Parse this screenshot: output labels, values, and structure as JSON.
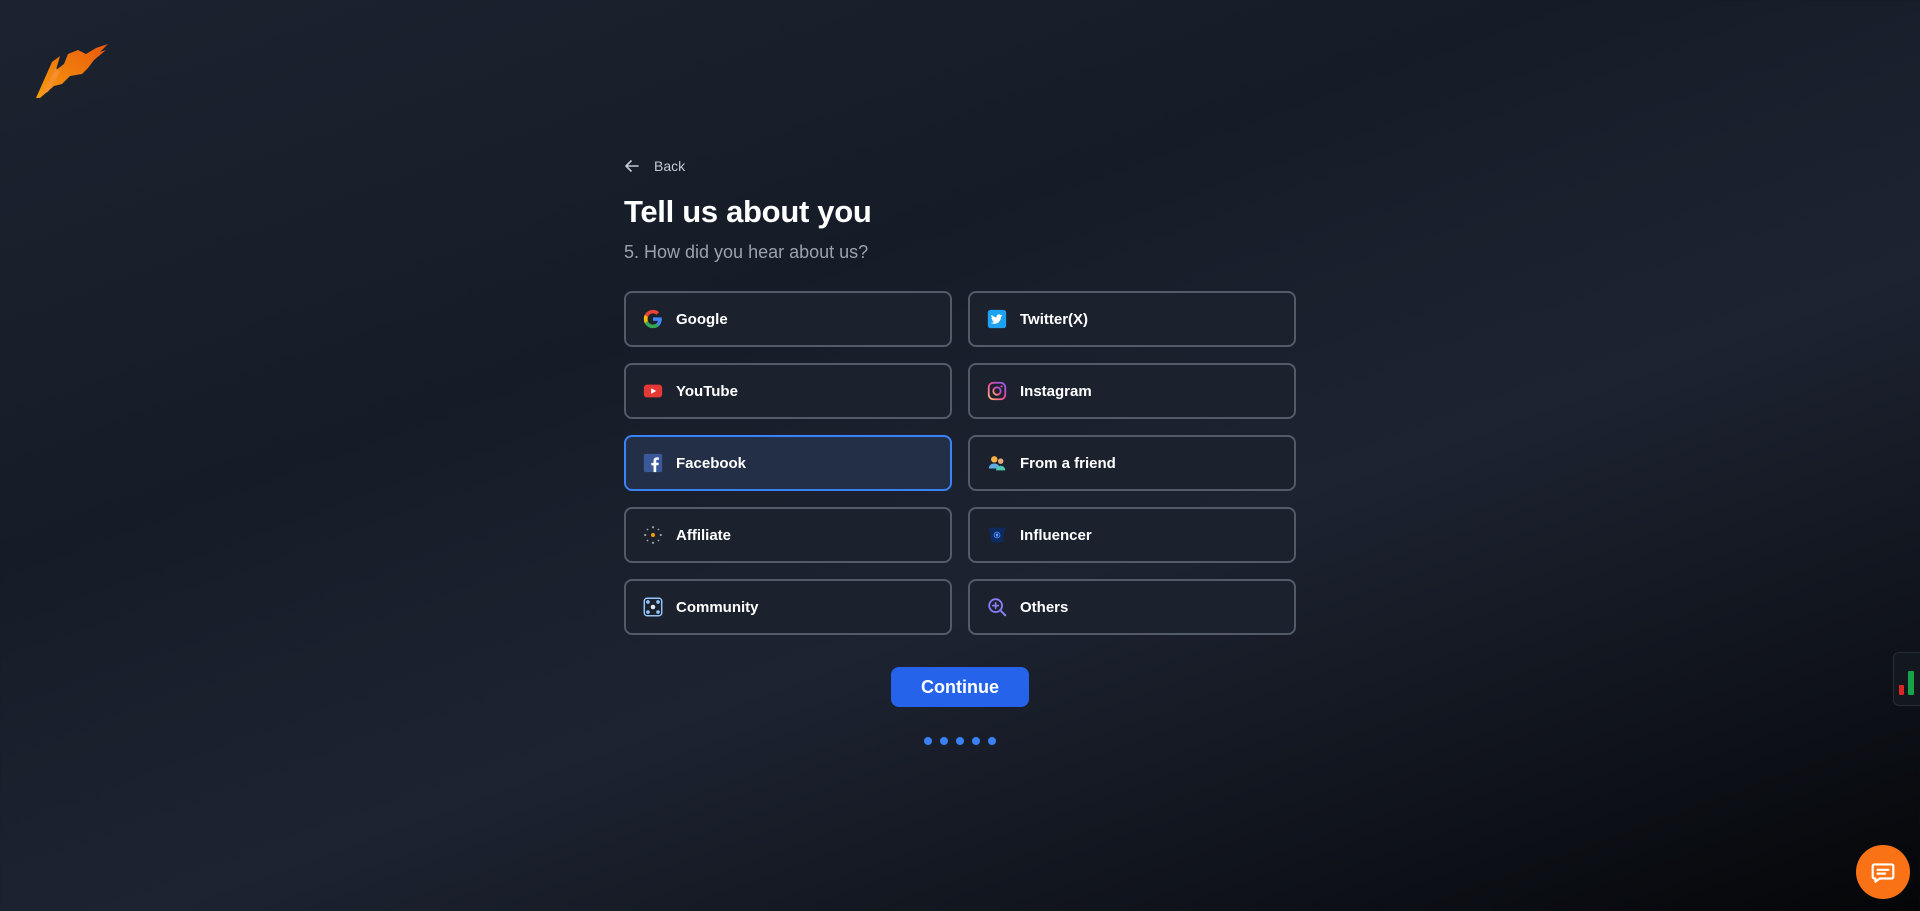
{
  "back": {
    "label": "Back"
  },
  "header": {
    "title": "Tell us about you",
    "subtitle": "5. How did you hear about us?"
  },
  "options": [
    {
      "label": "Google",
      "icon": "google-icon",
      "selected": false
    },
    {
      "label": "Twitter(X)",
      "icon": "twitter-icon",
      "selected": false
    },
    {
      "label": "YouTube",
      "icon": "youtube-icon",
      "selected": false
    },
    {
      "label": "Instagram",
      "icon": "instagram-icon",
      "selected": false
    },
    {
      "label": "Facebook",
      "icon": "facebook-icon",
      "selected": true
    },
    {
      "label": "From a friend",
      "icon": "friends-icon",
      "selected": false
    },
    {
      "label": "Affiliate",
      "icon": "affiliate-icon",
      "selected": false
    },
    {
      "label": "Influencer",
      "icon": "influencer-icon",
      "selected": false
    },
    {
      "label": "Community",
      "icon": "community-icon",
      "selected": false
    },
    {
      "label": "Others",
      "icon": "search-plus-icon",
      "selected": false
    }
  ],
  "continue": {
    "label": "Continue"
  },
  "progress": {
    "steps": 5
  },
  "colors": {
    "accent": "#2563eb",
    "brand": "#f97316",
    "selected_border": "#3b82f6"
  }
}
